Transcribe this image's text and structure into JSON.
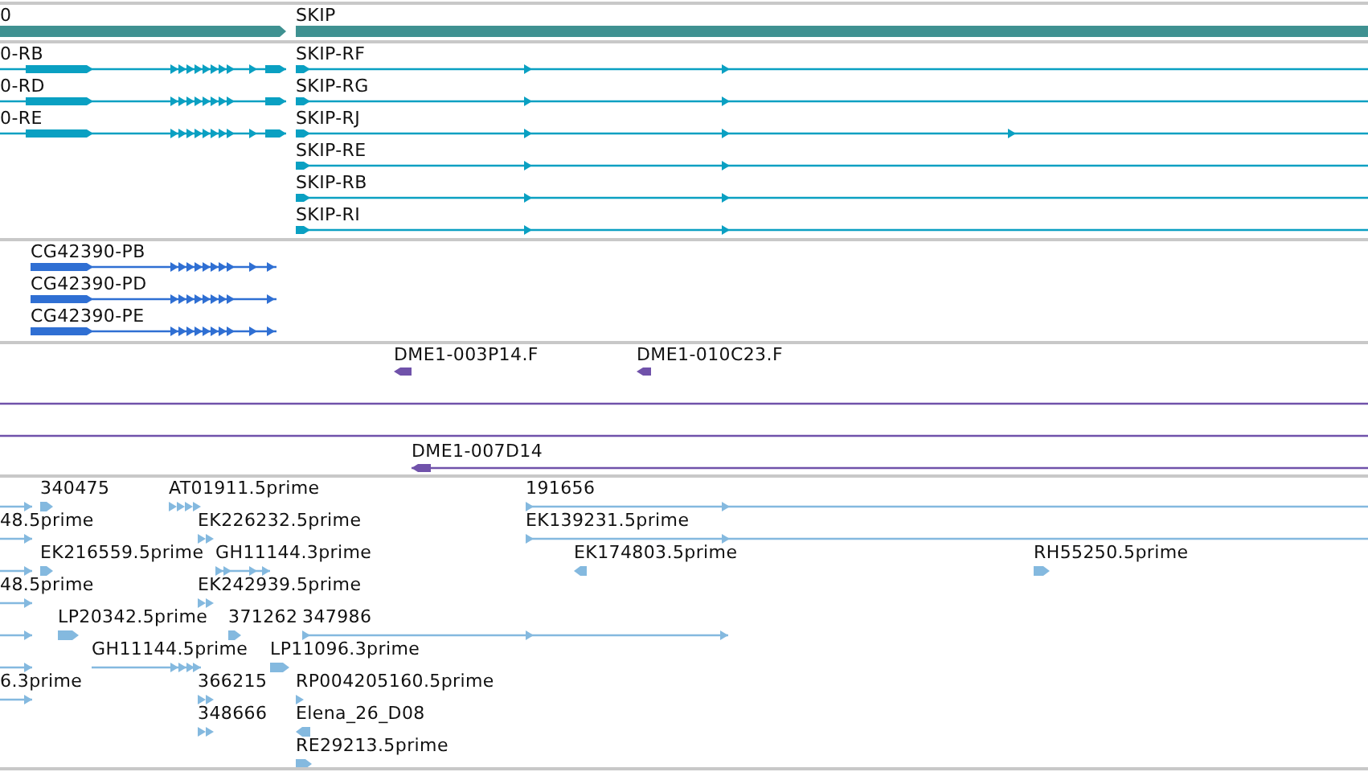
{
  "tracks": [
    {
      "kind": "gene",
      "features": [
        {
          "label": "0",
          "reverse": false
        },
        {
          "label": "SKIP",
          "reverse": false
        }
      ]
    },
    {
      "kind": "transcript",
      "features": [
        {
          "label": "0-RB",
          "reverse": false
        },
        {
          "label": "0-RD",
          "reverse": false
        },
        {
          "label": "0-RE",
          "reverse": false
        },
        {
          "label": "SKIP-RF",
          "reverse": false
        },
        {
          "label": "SKIP-RG",
          "reverse": false
        },
        {
          "label": "SKIP-RJ",
          "reverse": false
        },
        {
          "label": "SKIP-RE",
          "reverse": false
        },
        {
          "label": "SKIP-RB",
          "reverse": false
        },
        {
          "label": "SKIP-RI",
          "reverse": false
        }
      ]
    },
    {
      "kind": "protein",
      "features": [
        {
          "label": "CG42390-PB",
          "reverse": false
        },
        {
          "label": "CG42390-PD",
          "reverse": false
        },
        {
          "label": "CG42390-PE",
          "reverse": false
        }
      ]
    },
    {
      "kind": "clone",
      "features": [
        {
          "kind": "read",
          "label": "DME1-003P14.F",
          "reverse": true
        },
        {
          "kind": "read",
          "label": "DME1-010C23.F",
          "reverse": true
        },
        {
          "kind": "span"
        },
        {
          "kind": "span"
        },
        {
          "kind": "read",
          "label": "DME1-007D14",
          "reverse": true
        }
      ]
    },
    {
      "kind": "est",
      "features": [
        {
          "reverse": false
        },
        {
          "label": "340475",
          "reverse": false
        },
        {
          "label": "AT01911.5prime",
          "reverse": false
        },
        {
          "label": "191656",
          "reverse": false
        },
        {
          "label": "48.5prime",
          "reverse": false
        },
        {
          "label": "EK226232.5prime",
          "reverse": false
        },
        {
          "label": "EK139231.5prime",
          "reverse": false
        },
        {
          "reverse": false
        },
        {
          "label": "EK216559.5prime",
          "reverse": false
        },
        {
          "label": "GH11144.3prime",
          "reverse": false
        },
        {
          "label": "EK174803.5prime",
          "reverse": true
        },
        {
          "label": "RH55250.5prime",
          "reverse": false
        },
        {
          "label": "48.5prime",
          "reverse": false
        },
        {
          "label": "EK242939.5prime",
          "reverse": false
        },
        {
          "reverse": false
        },
        {
          "label": "LP20342.5prime",
          "reverse": false
        },
        {
          "label": "371262",
          "reverse": false
        },
        {
          "label": "347986",
          "reverse": false
        },
        {
          "reverse": false
        },
        {
          "label": "GH11144.5prime",
          "reverse": false
        },
        {
          "label": "LP11096.3prime",
          "reverse": false
        },
        {
          "label": "6.3prime",
          "reverse": false
        },
        {
          "label": "366215",
          "reverse": false
        },
        {
          "label": "RP004205160.5prime",
          "reverse": false
        },
        {
          "label": "348666",
          "reverse": false
        },
        {
          "label": "Elena_26_D08",
          "reverse": true
        },
        {
          "label": "RE29213.5prime",
          "reverse": false
        }
      ]
    }
  ]
}
